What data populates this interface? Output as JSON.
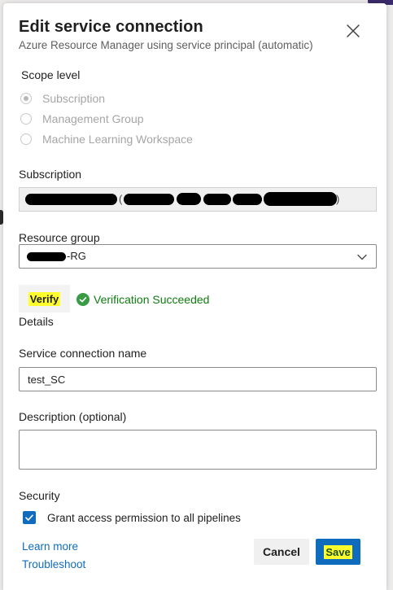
{
  "dialog": {
    "title": "Edit service connection",
    "subtitle": "Azure Resource Manager using service principal (automatic)"
  },
  "scope": {
    "label": "Scope level",
    "options": [
      "Subscription",
      "Management Group",
      "Machine Learning Workspace"
    ],
    "selected": "Subscription"
  },
  "subscription": {
    "label": "Subscription",
    "value_open_paren": "(",
    "value_close_paren": ")"
  },
  "resource_group": {
    "label": "Resource group",
    "value_suffix": "-RG"
  },
  "verify": {
    "button_label": "Verify",
    "status_text": "Verification Succeeded",
    "status_color": "#107c10"
  },
  "details": {
    "heading": "Details",
    "name_label": "Service connection name",
    "name_value": "test_SC",
    "description_label": "Description (optional)",
    "description_value": ""
  },
  "security": {
    "heading": "Security",
    "grant_label": "Grant access permission to all pipelines",
    "grant_checked": true
  },
  "footer": {
    "learn_more": "Learn more",
    "troubleshoot": "Troubleshoot",
    "cancel_label": "Cancel",
    "save_label": "Save"
  },
  "colors": {
    "accent": "#0f6cbd",
    "highlight": "#ffff2e"
  }
}
